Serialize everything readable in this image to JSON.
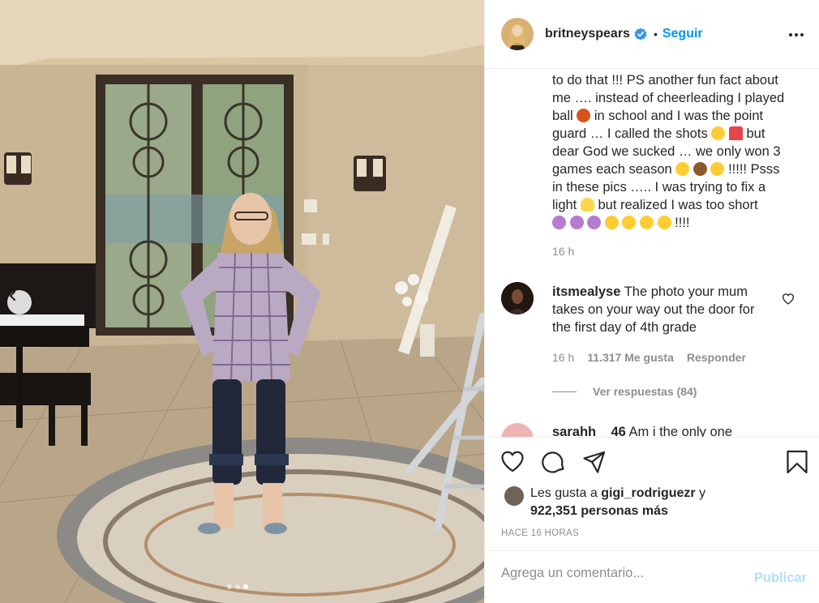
{
  "post": {
    "username": "britneyspears",
    "follow_label": "Seguir",
    "separator": "•"
  },
  "caption": {
    "lines": [
      "to do that !!! PS another fun fact about",
      "me …. instead of cheerleading I played",
      "ball",
      "in school and I was the point",
      "guard … I called the shots",
      "but",
      "dear God we sucked … we only won 3",
      "games each season",
      "!!!!! Psss",
      "in these pics ….. I was trying to fix a",
      "light",
      "but realized I was too short",
      "!!!!"
    ],
    "time": "16 h"
  },
  "comment": {
    "user": "itsmealyse",
    "text": "The photo your mum takes on your way out the door for the first day of 4th grade",
    "time": "16 h",
    "likes": "11.317 Me gusta",
    "reply_label": "Responder",
    "view_replies": "Ver respuestas (84)"
  },
  "next_comment": {
    "user": "sarahh__46",
    "text": "Am i the only one"
  },
  "likes": {
    "prefix": "Les gusta a",
    "user": "gigi_rodriguezr",
    "conj": "y",
    "others": "922,351 personas más"
  },
  "posted_ago": "HACE 16 HORAS",
  "add_comment": {
    "placeholder": "Agrega un comentario...",
    "publish_label": "Publicar"
  },
  "carousel": {
    "total": 3,
    "active": 3
  },
  "colors": {
    "accent": "#0095f6",
    "publish_disabled": "#b2dffc",
    "muted": "#8e8e8e"
  },
  "icons": [
    "chevron-left-icon",
    "verified-badge-icon",
    "more-options-icon",
    "heart-icon",
    "comment-icon",
    "share-icon",
    "bookmark-icon"
  ]
}
